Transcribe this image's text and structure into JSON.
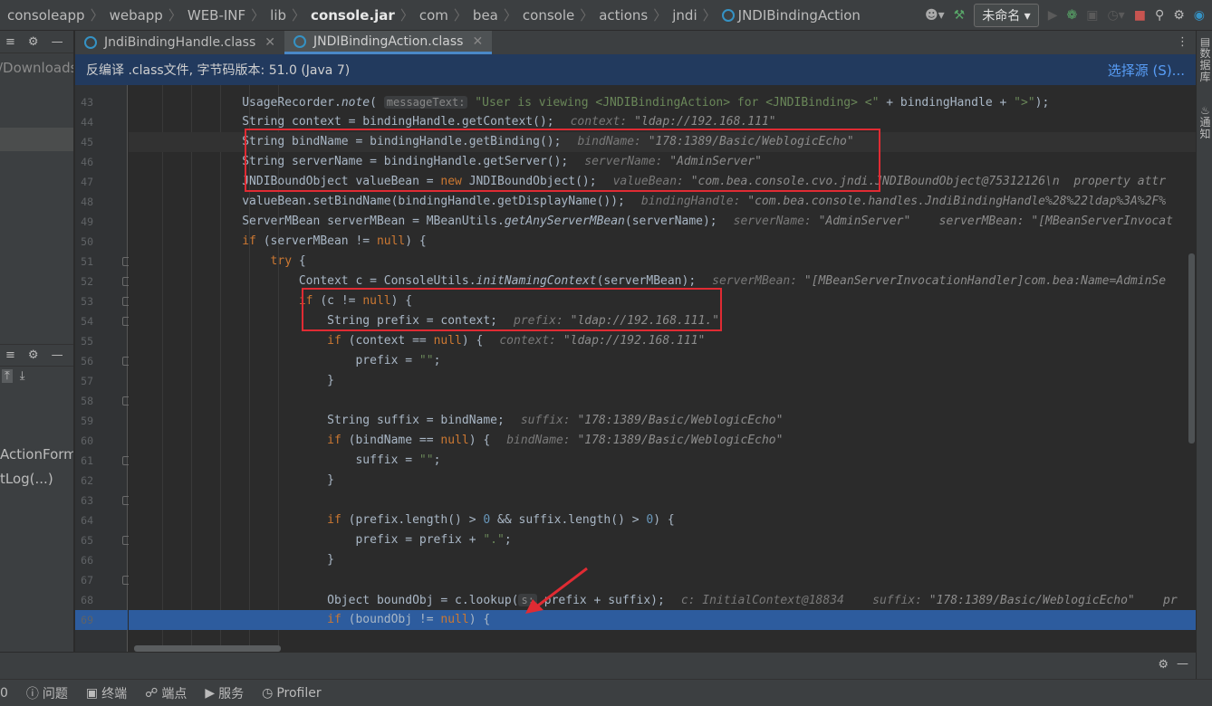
{
  "breadcrumb": [
    "consoleapp",
    "webapp",
    "WEB-INF",
    "lib",
    "console.jar",
    "com",
    "bea",
    "console",
    "actions",
    "jndi",
    "JNDIBindingAction"
  ],
  "toolbar": {
    "config": "未命名"
  },
  "tabs": [
    {
      "label": "JndiBindingHandle.class",
      "active": false
    },
    {
      "label": "JNDIBindingAction.class",
      "active": true
    }
  ],
  "infobar": {
    "text": "反编译 .class文件, 字节码版本: 51.0 (Java 7)",
    "action": "选择源 (S)..."
  },
  "left_panel": {
    "path_fragment": "/Downloads/",
    "items": [
      "ActionForm,",
      "tLog(...)"
    ]
  },
  "right_panel": {
    "database": "数据库",
    "notifications": "通知"
  },
  "code": {
    "first_line": 43,
    "caret_line": 45,
    "breakpoint_line": 69,
    "lines": [
      [
        [
          "",
          "UsageRecorder."
        ],
        [
          "it",
          "note"
        ],
        [
          "",
          "( "
        ],
        [
          "inl",
          "messageText:"
        ],
        [
          "st",
          " \"User is viewing <JNDIBindingAction> for <JNDIBinding> <\""
        ],
        [
          "",
          " + bindingHandle + "
        ],
        [
          "st",
          "\">\""
        ],
        [
          "",
          ");"
        ]
      ],
      [
        [
          "",
          "String context = bindingHandle.getContext();"
        ],
        [
          "hint",
          "context: ",
          "\"ldap://192.168.111\""
        ]
      ],
      [
        [
          "",
          "String bindName = bindingHandle.getBinding();"
        ],
        [
          "hint",
          "bindName: ",
          "\"178:1389/Basic/WeblogicEcho\""
        ]
      ],
      [
        [
          "",
          "String serverName = bindingHandle.getServer();"
        ],
        [
          "hint",
          "serverName: ",
          "\"AdminServer\""
        ]
      ],
      [
        [
          "",
          "JNDIBoundObject valueBean = "
        ],
        [
          "kw",
          "new"
        ],
        [
          "",
          " JNDIBoundObject();"
        ],
        [
          "hint",
          "valueBean: ",
          "\"com.bea.console.cvo.jndi.JNDIBoundObject@75312126\\n  property attr"
        ]
      ],
      [
        [
          "",
          "valueBean.setBindName(bindingHandle.getDisplayName());"
        ],
        [
          "hint",
          "bindingHandle: ",
          "\"com.bea.console.handles.JndiBindingHandle%28%22ldap%3A%2F%"
        ]
      ],
      [
        [
          "",
          "ServerMBean serverMBean = MBeanUtils."
        ],
        [
          "it",
          "getAnyServerMBean"
        ],
        [
          "",
          "(serverName);"
        ],
        [
          "hint",
          "serverName: ",
          "\"AdminServer\"    serverMBean: \"[MBeanServerInvocat"
        ]
      ],
      [
        [
          "kw",
          "if"
        ],
        [
          "",
          " (serverMBean != "
        ],
        [
          "kw",
          "null"
        ],
        [
          "",
          ") {"
        ]
      ],
      [
        [
          "",
          "    "
        ],
        [
          "kw",
          "try"
        ],
        [
          "",
          " {"
        ]
      ],
      [
        [
          "",
          "        Context c = ConsoleUtils."
        ],
        [
          "it",
          "initNamingContext"
        ],
        [
          "",
          "(serverMBean);"
        ],
        [
          "hint",
          "serverMBean: ",
          "\"[MBeanServerInvocationHandler]com.bea:Name=AdminSe"
        ]
      ],
      [
        [
          "",
          "        "
        ],
        [
          "kw",
          "if"
        ],
        [
          "",
          " (c != "
        ],
        [
          "kw",
          "null"
        ],
        [
          "",
          ") {"
        ]
      ],
      [
        [
          "",
          "            String prefix = context;"
        ],
        [
          "hint",
          "prefix: ",
          "\"ldap://192.168.111.\""
        ]
      ],
      [
        [
          "",
          "            "
        ],
        [
          "kw",
          "if"
        ],
        [
          "",
          " (context == "
        ],
        [
          "kw",
          "null"
        ],
        [
          "",
          ") {"
        ],
        [
          "hint",
          "context: ",
          "\"ldap://192.168.111\""
        ]
      ],
      [
        [
          "",
          "                prefix = "
        ],
        [
          "st",
          "\"\""
        ],
        [
          "",
          ";"
        ]
      ],
      [
        [
          "",
          "            }"
        ]
      ],
      [
        [
          "",
          ""
        ]
      ],
      [
        [
          "",
          "            String suffix = bindName;"
        ],
        [
          "hint",
          "suffix: ",
          "\"178:1389/Basic/WeblogicEcho\""
        ]
      ],
      [
        [
          "",
          "            "
        ],
        [
          "kw",
          "if"
        ],
        [
          "",
          " (bindName == "
        ],
        [
          "kw",
          "null"
        ],
        [
          "",
          ") {"
        ],
        [
          "hint",
          "bindName: ",
          "\"178:1389/Basic/WeblogicEcho\""
        ]
      ],
      [
        [
          "",
          "                suffix = "
        ],
        [
          "st",
          "\"\""
        ],
        [
          "",
          ";"
        ]
      ],
      [
        [
          "",
          "            }"
        ]
      ],
      [
        [
          "",
          ""
        ]
      ],
      [
        [
          "",
          "            "
        ],
        [
          "kw",
          "if"
        ],
        [
          "",
          " (prefix.length() > "
        ],
        [
          "nm",
          "0"
        ],
        [
          "",
          " && suffix.length() > "
        ],
        [
          "nm",
          "0"
        ],
        [
          "",
          ") {"
        ]
      ],
      [
        [
          "",
          "                prefix = prefix + "
        ],
        [
          "st",
          "\".\""
        ],
        [
          "",
          ";"
        ]
      ],
      [
        [
          "",
          "            }"
        ]
      ],
      [
        [
          "",
          ""
        ]
      ],
      [
        [
          "",
          "            Object boundObj = c.lookup("
        ],
        [
          "inl",
          "s:"
        ],
        [
          "",
          " prefix + suffix);"
        ],
        [
          "hint",
          "c: InitialContext@18834    suffix: ",
          "\"178:1389/Basic/WeblogicEcho\"    pr"
        ]
      ],
      [
        [
          "",
          "            "
        ],
        [
          "kw",
          "if"
        ],
        [
          "",
          " (boundObj != "
        ],
        [
          "kw",
          "null"
        ],
        [
          "",
          ") {"
        ]
      ]
    ]
  },
  "status_bar": [
    "0",
    "问题",
    "终端",
    "端点",
    "服务",
    "Profiler"
  ]
}
